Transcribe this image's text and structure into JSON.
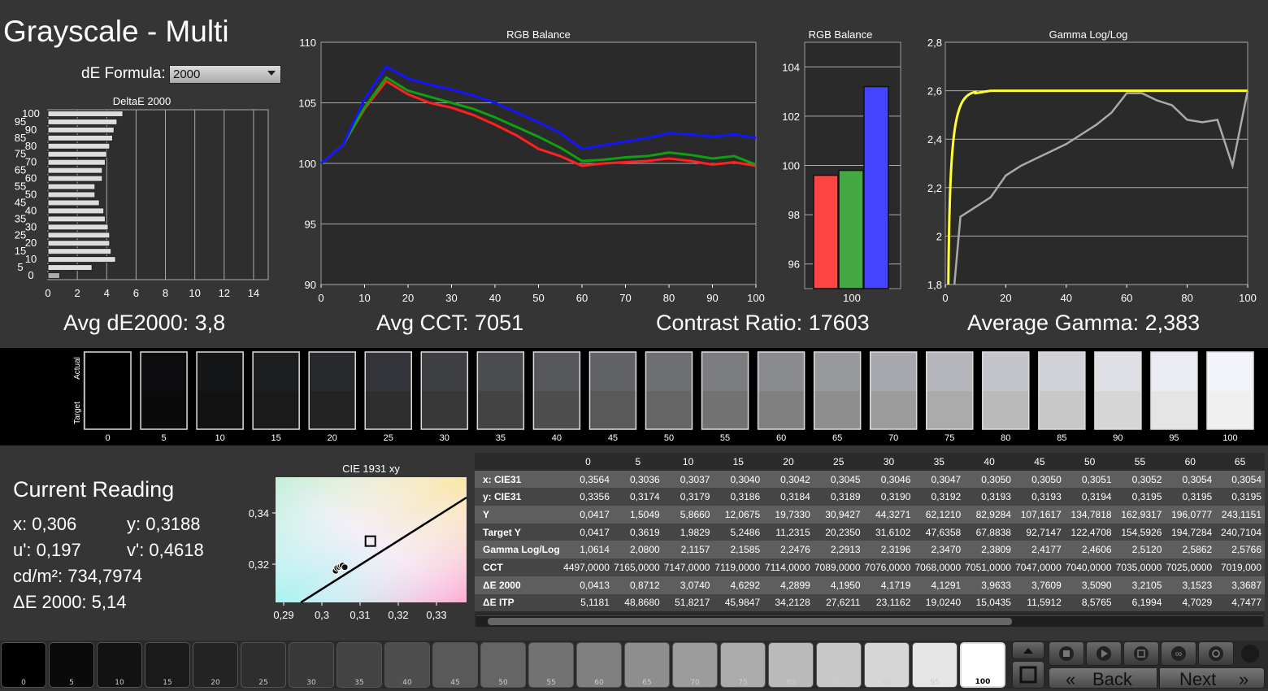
{
  "title": "Grayscale - Multi",
  "de_formula": {
    "label": "dE Formula:",
    "value": "2000"
  },
  "summary": {
    "avg_de": "Avg dE2000: 3,8",
    "avg_cct": "Avg CCT: 7051",
    "contrast": "Contrast Ratio: 17603",
    "gamma": "Average Gamma: 2,383"
  },
  "chart_data": [
    {
      "type": "bar",
      "title": "DeltaE 2000",
      "orientation": "horizontal",
      "categories": [
        "0",
        "5",
        "10",
        "15",
        "20",
        "25",
        "30",
        "35",
        "40",
        "45",
        "50",
        "55",
        "60",
        "65",
        "70",
        "75",
        "80",
        "85",
        "90",
        "95",
        "100"
      ],
      "values": [
        0.8,
        3.0,
        4.6,
        4.3,
        4.2,
        4.2,
        4.1,
        3.9,
        3.8,
        3.5,
        3.2,
        3.2,
        3.7,
        3.7,
        3.9,
        4.0,
        4.2,
        4.4,
        4.5,
        4.7,
        5.1
      ],
      "y_tick_labels": [
        "100",
        "95",
        "90",
        "85",
        "80",
        "75",
        "70",
        "65",
        "60",
        "55",
        "50",
        "45",
        "40",
        "35",
        "30",
        "25",
        "20",
        "15",
        "10",
        "5",
        "0"
      ],
      "x_ticks": [
        "0",
        "2",
        "4",
        "6",
        "8",
        "10",
        "12",
        "14"
      ],
      "xlim": [
        0,
        15
      ]
    },
    {
      "type": "line",
      "title": "RGB Balance",
      "x": [
        0,
        5,
        10,
        15,
        20,
        25,
        30,
        35,
        40,
        45,
        50,
        55,
        60,
        65,
        70,
        75,
        80,
        85,
        90,
        95,
        100
      ],
      "series": [
        {
          "color": "#ff2020",
          "values": [
            100,
            101.5,
            104.5,
            106.8,
            105.7,
            105.0,
            104.6,
            104.0,
            103.2,
            102.3,
            101.2,
            100.6,
            99.8,
            100.0,
            100.1,
            100.2,
            100.4,
            100.2,
            99.9,
            100.1,
            99.8
          ]
        },
        {
          "color": "#10a010",
          "values": [
            100,
            101.5,
            104.6,
            107.1,
            106.0,
            105.5,
            105.0,
            104.5,
            103.8,
            103.0,
            102.2,
            101.3,
            100.2,
            100.3,
            100.5,
            100.6,
            100.9,
            100.7,
            100.4,
            100.6,
            99.9
          ]
        },
        {
          "color": "#1414ff",
          "values": [
            100,
            101.5,
            105.3,
            108.0,
            107.0,
            106.5,
            106.1,
            105.6,
            105.0,
            104.2,
            103.4,
            102.5,
            101.2,
            101.5,
            101.8,
            102.1,
            102.5,
            102.4,
            102.2,
            102.4,
            102.1
          ]
        }
      ],
      "xlim": [
        0,
        100
      ],
      "ylim": [
        90,
        110
      ],
      "x_ticks": [
        "0",
        "10",
        "20",
        "30",
        "40",
        "50",
        "60",
        "70",
        "80",
        "90",
        "100"
      ],
      "y_ticks": [
        "90",
        "95",
        "100",
        "105",
        "110"
      ]
    },
    {
      "type": "bar",
      "title": "RGB Balance",
      "categories": [
        "100"
      ],
      "series": [
        {
          "color": "#ff4444",
          "values": [
            99.6
          ]
        },
        {
          "color": "#44a844",
          "values": [
            99.8
          ]
        },
        {
          "color": "#4444ff",
          "values": [
            103.2
          ]
        }
      ],
      "ylim": [
        95,
        105
      ],
      "y_ticks": [
        "96",
        "98",
        "100",
        "102",
        "104"
      ]
    },
    {
      "type": "line",
      "title": "Gamma Log/Log",
      "x": [
        0,
        5,
        10,
        15,
        20,
        25,
        30,
        35,
        40,
        45,
        50,
        55,
        60,
        65,
        70,
        75,
        80,
        85,
        90,
        95,
        100
      ],
      "series": [
        {
          "color": "#ffff33",
          "values": [
            1.8,
            2.53,
            2.59,
            2.6,
            2.6,
            2.6,
            2.6,
            2.6,
            2.6,
            2.6,
            2.6,
            2.6,
            2.6,
            2.6,
            2.6,
            2.6,
            2.6,
            2.6,
            2.6,
            2.6,
            2.6
          ]
        },
        {
          "color": "#aaaaaa",
          "values": [
            1.8,
            2.08,
            2.12,
            2.16,
            2.25,
            2.29,
            2.32,
            2.35,
            2.38,
            2.42,
            2.46,
            2.51,
            2.59,
            2.59,
            2.56,
            2.54,
            2.48,
            2.47,
            2.48,
            2.29,
            2.6
          ]
        }
      ],
      "xlim": [
        0,
        100
      ],
      "ylim": [
        1.8,
        2.8
      ],
      "x_ticks": [
        "0",
        "20",
        "40",
        "60",
        "80",
        "100"
      ],
      "y_ticks": [
        "1,8",
        "2",
        "2,2",
        "2,4",
        "2,6",
        "2,8"
      ]
    },
    {
      "type": "scatter",
      "title": "CIE 1931 xy",
      "x_ticks": [
        "0,29",
        "0,3",
        "0,31",
        "0,32",
        "0,33"
      ],
      "y_ticks": [
        "0,32",
        "0,34"
      ],
      "target_point": [
        0.3127,
        0.329
      ],
      "measured_points": [
        [
          0.3036,
          0.3174
        ],
        [
          0.304,
          0.3186
        ],
        [
          0.3045,
          0.3189
        ],
        [
          0.305,
          0.3193
        ],
        [
          0.3054,
          0.3195
        ],
        [
          0.306,
          0.3188
        ]
      ]
    }
  ],
  "swatches": {
    "labels": [
      "0",
      "5",
      "10",
      "15",
      "20",
      "25",
      "30",
      "35",
      "40",
      "45",
      "50",
      "55",
      "60",
      "65",
      "70",
      "75",
      "80",
      "85",
      "90",
      "95",
      "100"
    ],
    "row_labels": [
      "Actual",
      "Target"
    ],
    "actual": [
      "#000000",
      "#0c0c0e",
      "#151618",
      "#1d1e20",
      "#28292c",
      "#34353a",
      "#3e3f43",
      "#4b4c50",
      "#57585c",
      "#626366",
      "#6e6f73",
      "#7b7c80",
      "#8a8b8f",
      "#98999d",
      "#a8a9ae",
      "#b6b7bc",
      "#c4c5ca",
      "#d1d2d8",
      "#dfe0e6",
      "#eaebf3",
      "#f3f4fb"
    ],
    "target": [
      "#000000",
      "#0a0a0a",
      "#121212",
      "#1a1a1a",
      "#232323",
      "#2e2e2e",
      "#383838",
      "#434343",
      "#4e4e4e",
      "#595959",
      "#656565",
      "#727272",
      "#808080",
      "#8e8e8e",
      "#9c9c9c",
      "#ababab",
      "#bababa",
      "#c8c8c8",
      "#d6d6d6",
      "#e5e5e5",
      "#f0f0f0"
    ]
  },
  "current_reading": {
    "title": "Current Reading",
    "x": "x: 0,306",
    "y": "y: 0,3188",
    "u": "u': 0,197",
    "v": "v': 0,4618",
    "cd": "cd/m²: 734,7974",
    "de": "ΔE 2000: 5,14"
  },
  "table": {
    "columns": [
      "0",
      "5",
      "10",
      "15",
      "20",
      "25",
      "30",
      "35",
      "40",
      "45",
      "50",
      "55",
      "60",
      "65"
    ],
    "rows": [
      {
        "label": "x: CIE31",
        "values": [
          "0,3564",
          "0,3036",
          "0,3037",
          "0,3040",
          "0,3042",
          "0,3045",
          "0,3046",
          "0,3047",
          "0,3050",
          "0,3050",
          "0,3051",
          "0,3052",
          "0,3054",
          "0,3054"
        ]
      },
      {
        "label": "y: CIE31",
        "values": [
          "0,3356",
          "0,3174",
          "0,3179",
          "0,3186",
          "0,3184",
          "0,3189",
          "0,3190",
          "0,3192",
          "0,3193",
          "0,3193",
          "0,3194",
          "0,3195",
          "0,3195",
          "0,3195"
        ]
      },
      {
        "label": "Y",
        "values": [
          "0,0417",
          "1,5049",
          "5,8660",
          "12,0675",
          "19,7330",
          "30,9427",
          "44,3271",
          "62,1210",
          "82,9284",
          "107,1617",
          "134,7818",
          "162,9317",
          "196,0777",
          "243,1151"
        ]
      },
      {
        "label": "Target Y",
        "values": [
          "0,0417",
          "0,3619",
          "1,9829",
          "5,2486",
          "11,2315",
          "20,2350",
          "31,6102",
          "47,6358",
          "67,8838",
          "92,7147",
          "122,4708",
          "154,5926",
          "194,7284",
          "240,7104"
        ]
      },
      {
        "label": "Gamma Log/Log",
        "values": [
          "1,0614",
          "2,0800",
          "2,1157",
          "2,1585",
          "2,2476",
          "2,2913",
          "2,3196",
          "2,3470",
          "2,3809",
          "2,4177",
          "2,4606",
          "2,5120",
          "2,5862",
          "2,5766"
        ]
      },
      {
        "label": "CCT",
        "values": [
          "4497,0000",
          "7165,0000",
          "7147,0000",
          "7119,0000",
          "7114,0000",
          "7089,0000",
          "7076,0000",
          "7068,0000",
          "7051,0000",
          "7047,0000",
          "7040,0000",
          "7035,0000",
          "7025,0000",
          "7019,000"
        ]
      },
      {
        "label": "ΔE 2000",
        "values": [
          "0,0413",
          "0,8712",
          "3,0740",
          "4,6292",
          "4,2899",
          "4,1950",
          "4,1719",
          "4,1291",
          "3,9633",
          "3,7609",
          "3,5090",
          "3,2105",
          "3,1523",
          "3,3687"
        ]
      },
      {
        "label": "ΔE ITP",
        "values": [
          "5,1181",
          "48,8680",
          "51,8217",
          "45,9847",
          "34,2128",
          "27,6211",
          "23,1162",
          "19,0240",
          "15,0435",
          "11,5912",
          "8,5765",
          "6,1994",
          "4,7029",
          "4,7477"
        ]
      }
    ]
  },
  "footer": {
    "patch_labels": [
      "0",
      "5",
      "10",
      "15",
      "20",
      "25",
      "30",
      "35",
      "40",
      "45",
      "50",
      "55",
      "60",
      "65",
      "70",
      "75",
      "80",
      "85",
      "90",
      "95",
      "100"
    ],
    "back_label": "Back",
    "next_label": "Next"
  }
}
